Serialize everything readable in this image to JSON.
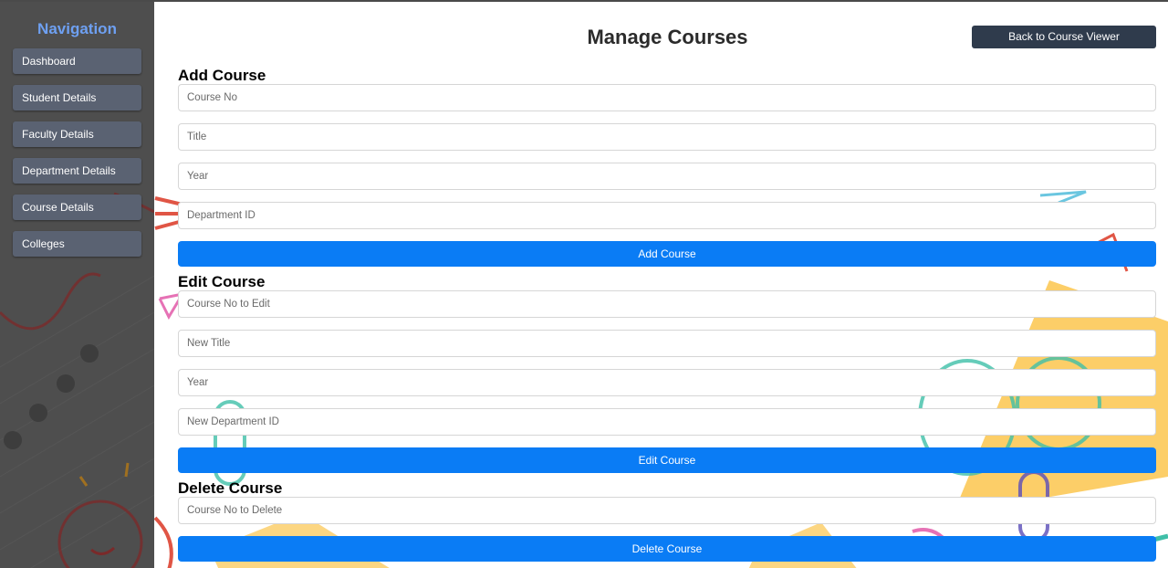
{
  "sidebar": {
    "title": "Navigation",
    "items": [
      {
        "label": "Dashboard"
      },
      {
        "label": "Student Details"
      },
      {
        "label": "Faculty Details"
      },
      {
        "label": "Department Details"
      },
      {
        "label": "Course Details"
      },
      {
        "label": "Colleges"
      }
    ]
  },
  "header": {
    "title": "Manage Courses",
    "back_button": "Back to Course Viewer"
  },
  "add_course": {
    "title": "Add Course",
    "fields": {
      "course_no": "Course No",
      "title": "Title",
      "year": "Year",
      "department_id": "Department ID"
    },
    "button": "Add Course"
  },
  "edit_course": {
    "title": "Edit Course",
    "fields": {
      "course_no": "Course No to Edit",
      "title": "New Title",
      "year": "Year",
      "department_id": "New Department ID"
    },
    "button": "Edit Course"
  },
  "delete_course": {
    "title": "Delete Course",
    "fields": {
      "course_no": "Course No to Delete"
    },
    "button": "Delete Course"
  },
  "colors": {
    "sidebar_bg": "#484848",
    "nav_title": "#6ea0f2",
    "nav_item": "#5a6272",
    "back_button": "#2f3b4c",
    "primary_button": "#0a7cf5"
  }
}
